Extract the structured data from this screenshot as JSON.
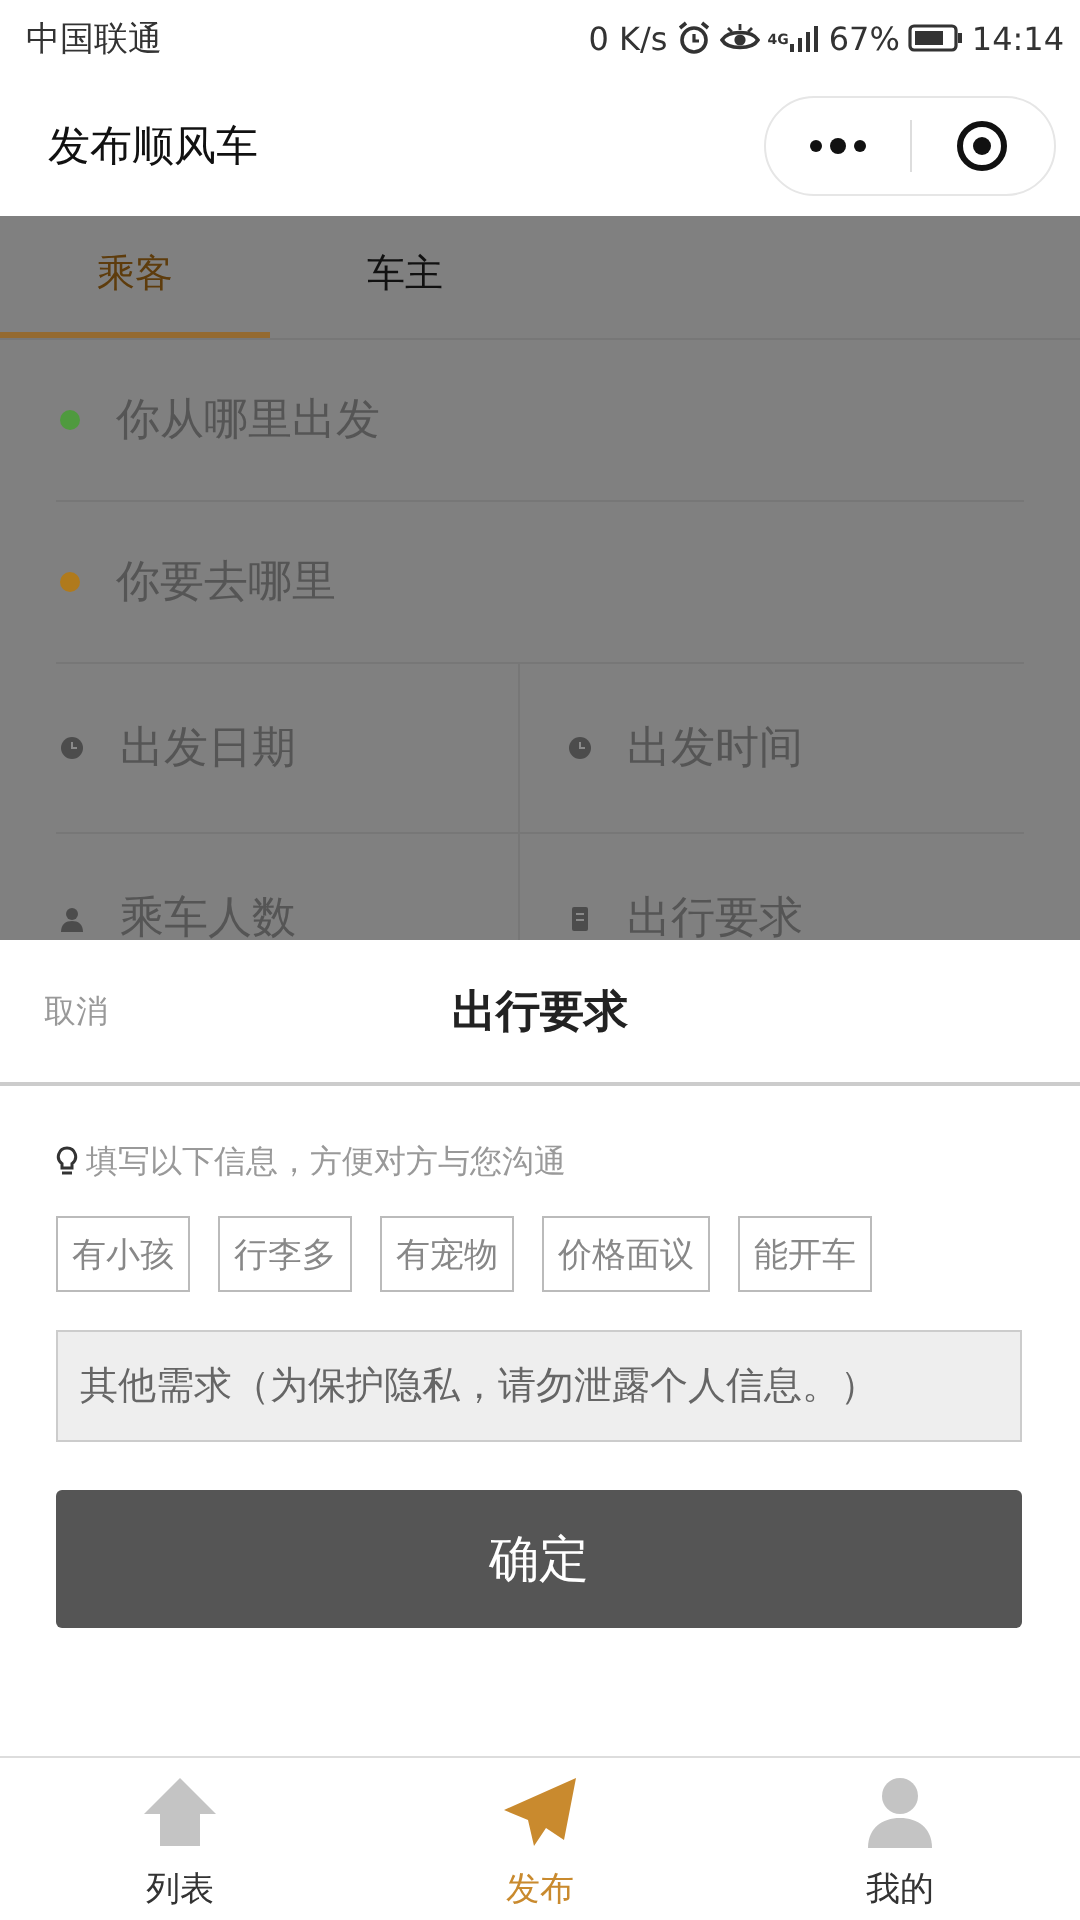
{
  "status_bar": {
    "carrier": "中国联通",
    "speed": "0 K/s",
    "network": "4G",
    "battery": "67%",
    "time": "14:14"
  },
  "nav_bar": {
    "title": "发布顺风车"
  },
  "tabs": [
    {
      "label": "乘客",
      "selected": true
    },
    {
      "label": "车主",
      "selected": false
    }
  ],
  "form_rows": [
    {
      "kind": "single",
      "fields": [
        {
          "kind": "dot",
          "color": "#4f9a3e",
          "placeholder": "你从哪里出发"
        }
      ]
    },
    {
      "kind": "single",
      "fields": [
        {
          "kind": "dot",
          "color": "#b07a1c",
          "placeholder": "你要去哪里"
        }
      ]
    },
    {
      "kind": "split",
      "fields": [
        {
          "kind": "clock",
          "placeholder": "出发日期"
        },
        {
          "kind": "clock",
          "placeholder": "出发时间"
        }
      ]
    },
    {
      "kind": "split",
      "fields": [
        {
          "kind": "person",
          "placeholder": "乘车人数"
        },
        {
          "kind": "note",
          "placeholder": "出行要求"
        }
      ]
    }
  ],
  "sheet": {
    "cancel": "取消",
    "title": "出行要求",
    "hint": "填写以下信息，方便对方与您沟通",
    "tags": [
      "有小孩",
      "行李多",
      "有宠物",
      "价格面议",
      "能开车"
    ],
    "input": {
      "placeholder": "其他需求（为保护隐私，请勿泄露个人信息。）"
    },
    "confirm": "确定"
  },
  "tab_bar": [
    {
      "kind": "house",
      "label": "列表",
      "selected": false
    },
    {
      "kind": "plane",
      "label": "发布",
      "selected": true
    },
    {
      "kind": "person",
      "label": "我的",
      "selected": false
    }
  ]
}
